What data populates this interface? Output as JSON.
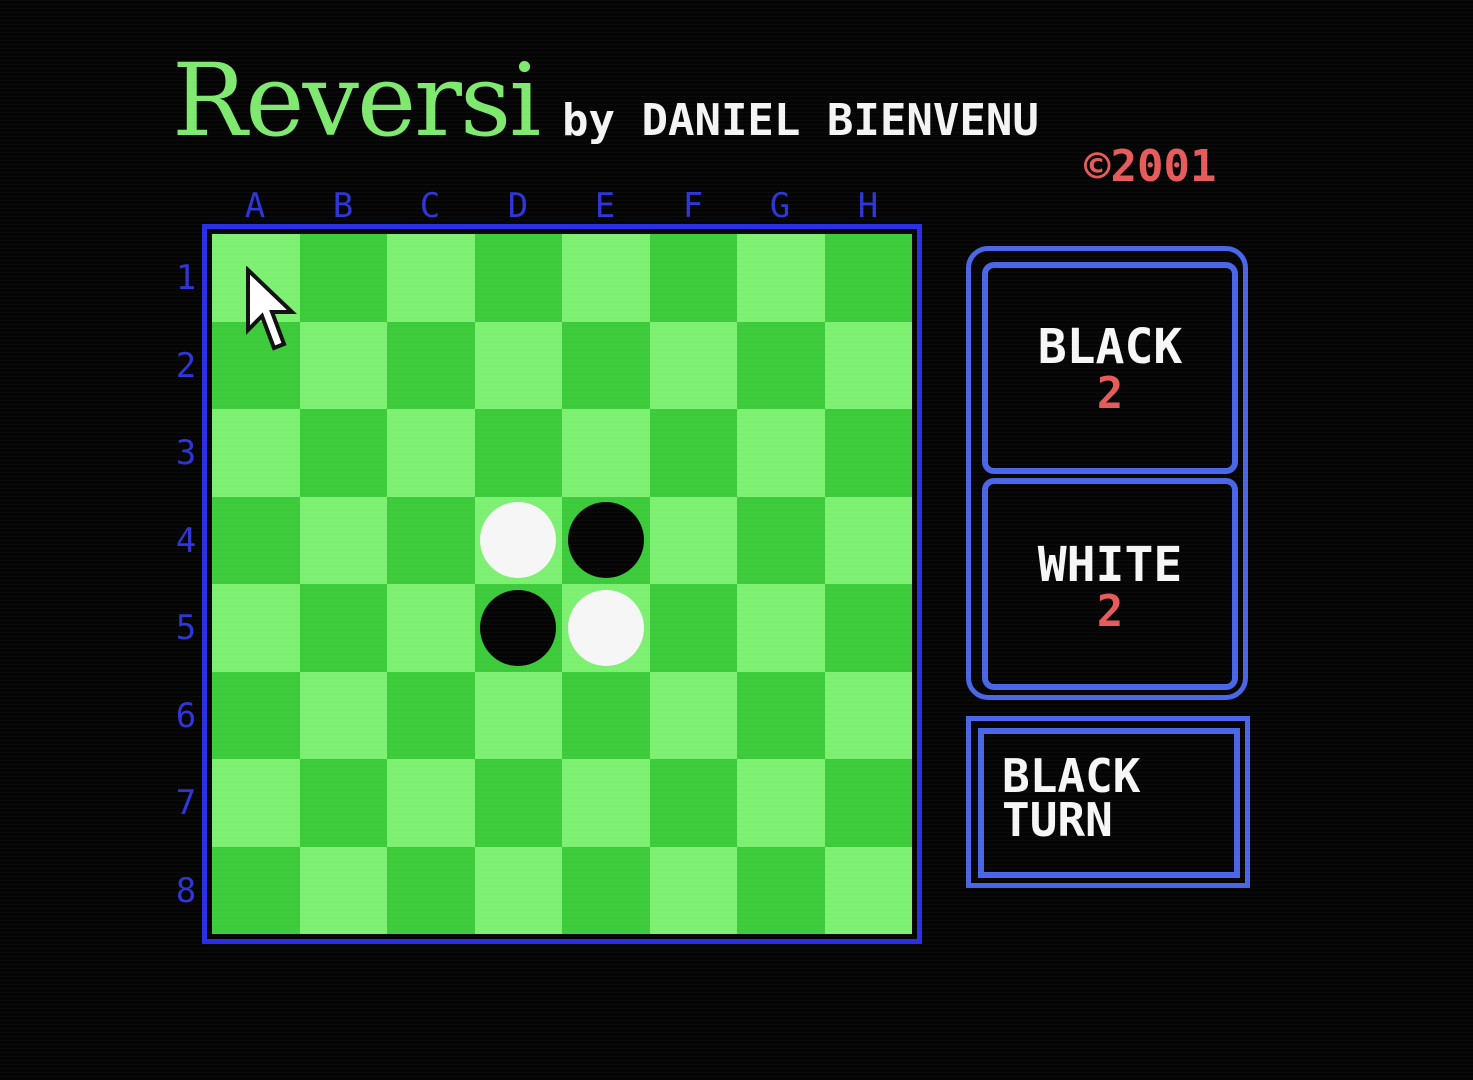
{
  "app": {
    "title": "Reversi",
    "byline": "by DANIEL BIENVENU",
    "copyright": "©2001"
  },
  "colors": {
    "title_green": "#7ee86f",
    "label_blue": "#2f34d8",
    "frame_blue": "#2a2ee6",
    "panel_blue": "#4a66e8",
    "light_square": "#7cf070",
    "dark_square": "#3ccb3a",
    "score_red": "#e85a5a",
    "disc_black": "#050505",
    "disc_white": "#f6f6f6"
  },
  "board": {
    "columns": [
      "A",
      "B",
      "C",
      "D",
      "E",
      "F",
      "G",
      "H"
    ],
    "rows": [
      "1",
      "2",
      "3",
      "4",
      "5",
      "6",
      "7",
      "8"
    ],
    "discs": [
      {
        "square": "D4",
        "color": "white"
      },
      {
        "square": "E4",
        "color": "black"
      },
      {
        "square": "D5",
        "color": "black"
      },
      {
        "square": "E5",
        "color": "white"
      }
    ],
    "cursor_square": "A1"
  },
  "scores": {
    "black_label": "BLACK",
    "black_value": "2",
    "white_label": "WHITE",
    "white_value": "2"
  },
  "turn": {
    "text": "BLACK\nTURN"
  },
  "icons": {
    "pointer": "arrow-cursor-icon"
  }
}
